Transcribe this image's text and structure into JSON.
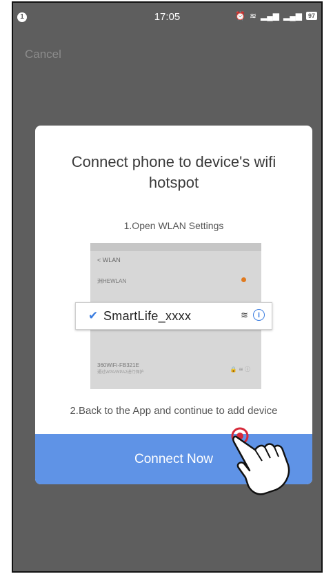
{
  "status_bar": {
    "notification_badge": "1",
    "time": "17:05",
    "icons": [
      "alarm-icon",
      "wifi-icon",
      "signal-icon",
      "signal-icon"
    ],
    "battery": "97"
  },
  "header": {
    "cancel_label": "Cancel"
  },
  "dialog": {
    "title": "Connect phone to device's wifi hotspot",
    "step1": "1.Open WLAN Settings",
    "wlan_screenshot": {
      "header": "< WLAN",
      "rows": [
        "洲HEWLAN",
        "",
        "",
        "",
        "SMARTLIFE"
      ],
      "other_ssid": "360WiFi-FB321E",
      "other_ssid_sub": "通过WPA/WPA2进行保护"
    },
    "highlight_ssid": "SmartLife_xxxx",
    "step2": "2.Back to the App and continue to add device",
    "connect_label": "Connect Now"
  },
  "colors": {
    "accent": "#5f93e6",
    "check": "#3b7de0",
    "overlay": "#5e5e5e"
  }
}
